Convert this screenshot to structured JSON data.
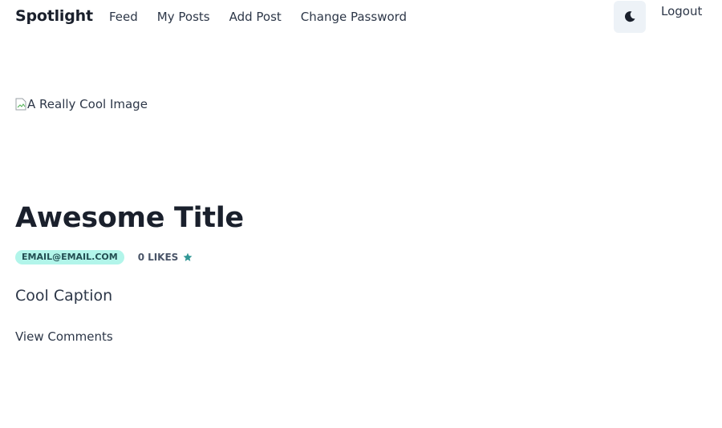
{
  "nav": {
    "brand": "Spotlight",
    "links": [
      {
        "label": "Feed"
      },
      {
        "label": "My Posts"
      },
      {
        "label": "Add Post"
      },
      {
        "label": "Change Password"
      }
    ],
    "theme_toggle_icon": "moon-icon",
    "logout_label": "Logout"
  },
  "post": {
    "image_alt": "A Really Cool Image",
    "title": "Awesome Title",
    "author_email": "EMAIL@EMAIL.COM",
    "likes_count": "0",
    "likes_label": "LIKES",
    "likes_icon": "star-icon",
    "caption": "Cool Caption",
    "view_comments_label": "View Comments"
  },
  "colors": {
    "badge_bg": "#b2f5ea",
    "badge_text": "#234e52",
    "star": "#319795",
    "toggle_bg": "#edf2f7"
  }
}
